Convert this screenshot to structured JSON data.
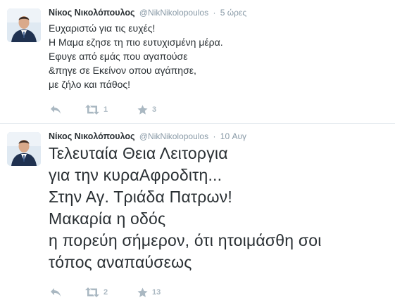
{
  "tweets": [
    {
      "fullname": "Νίκος Νικολόπουλος",
      "username": "@NikNikolopoulos",
      "separator": "·",
      "time": "5 ώρες",
      "lines": [
        "Ευχαριστώ για τις ευχές!",
        "Η Μαμα εζησε τη πιο ευτυχισμένη μέρα.",
        "Εφυγε από εμάς που αγαπούσε",
        "&πηγε σε Εκείνον οπου αγάπησε,",
        "με ζήλο και πάθος!"
      ],
      "retweets": "1",
      "favorites": "3"
    },
    {
      "fullname": "Νίκος Νικολόπουλος",
      "username": "@NikNikolopoulos",
      "separator": "·",
      "time": "10 Αυγ",
      "lines": [
        "Τελευταία Θεια Λειτοργια",
        "για την κυραΑφροδιτη...",
        "Στην Αγ. Τριάδα Πατρων!",
        "Μακαρία η οδός",
        "η πορεύη σήμερον, ότι ητοιμάσθη σοι",
        "τόπος αναπαύσεως"
      ],
      "retweets": "2",
      "favorites": "13"
    }
  ],
  "icons": {
    "reply": "reply-icon",
    "retweet": "retweet-icon",
    "favorite": "star-icon",
    "avatar": "avatar-portrait"
  },
  "colors": {
    "text": "#292f33",
    "muted": "#8899a6",
    "action": "#aab8c2",
    "divider": "#e1e8ed"
  }
}
